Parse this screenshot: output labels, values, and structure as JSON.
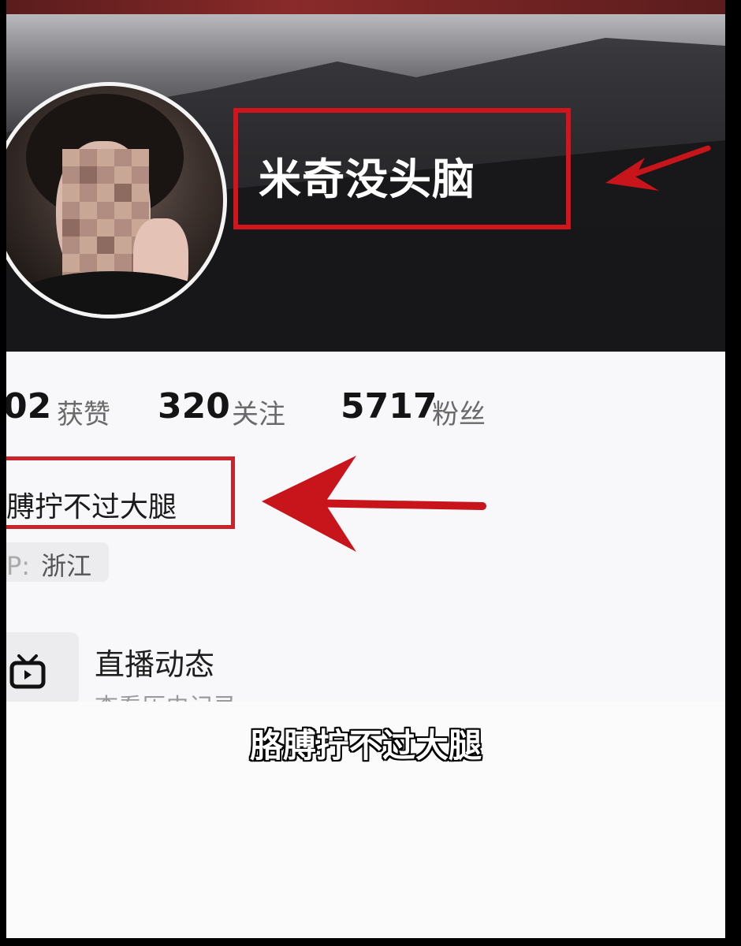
{
  "profile": {
    "name": "米奇没头脑",
    "bio": "膊拧不过大腿",
    "location": "浙江",
    "location_prefix": "P:"
  },
  "stats": [
    {
      "value": "02",
      "label": "获赞"
    },
    {
      "value": "320",
      "label": "关注"
    },
    {
      "value": "5717",
      "label": "粉丝"
    }
  ],
  "live_section": {
    "title": "直播动态",
    "subtitle": "查看历史记录"
  },
  "video_caption": "胳膊拧不过大腿",
  "colors": {
    "highlight_red": "#d0161c",
    "arrow_red": "#c8141b"
  },
  "icons": {
    "live": "tv-icon",
    "annotation_arrow": "red-arrow-icon"
  }
}
